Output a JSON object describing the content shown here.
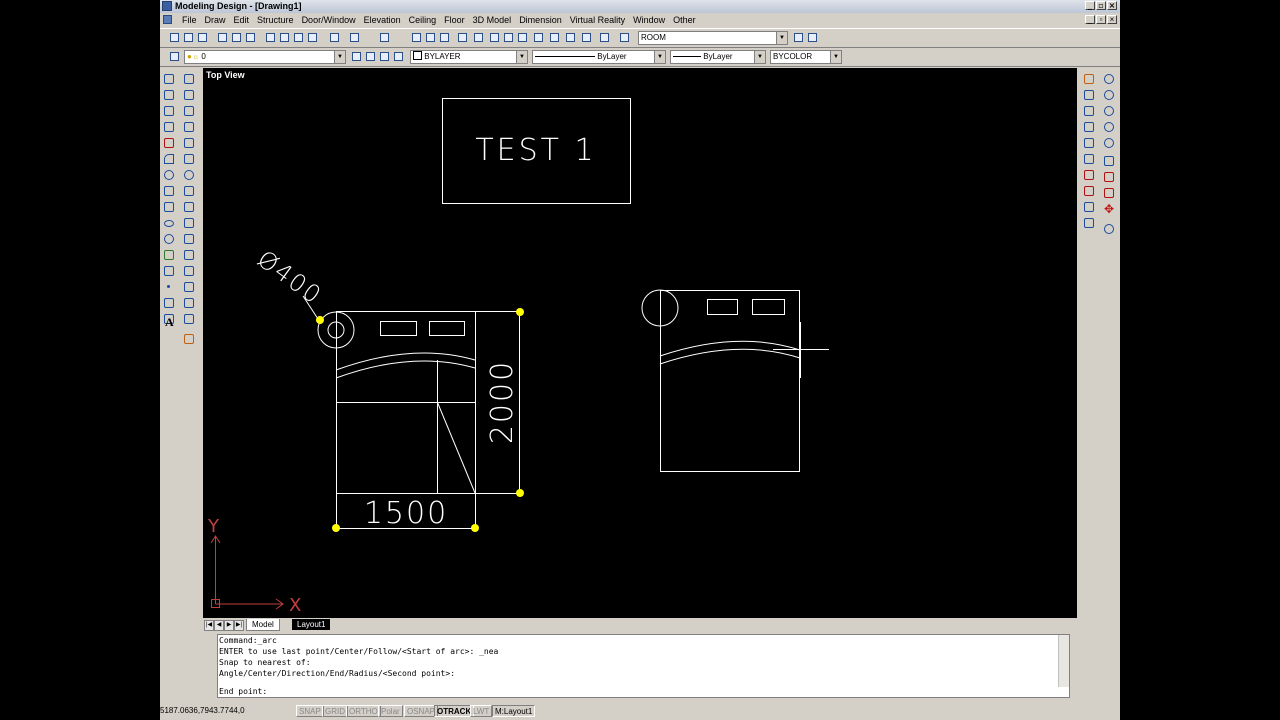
{
  "window": {
    "title": "Modeling Design - [Drawing1]"
  },
  "menu": [
    "File",
    "Draw",
    "Edit",
    "Structure",
    "Door/Window",
    "Elevation",
    "Ceiling",
    "Floor",
    "3D Model",
    "Dimension",
    "Virtual Reality",
    "Window",
    "Other"
  ],
  "toolbar": {
    "room_combo": "ROOM"
  },
  "layers_toolbar": {
    "layer": "0",
    "color": "BYLAYER",
    "linetype": "ByLayer",
    "lineweight": "ByLayer",
    "plotstyle": "BYCOLOR"
  },
  "viewport": {
    "label": "Top View",
    "test_text": "TEST 1",
    "dim_diameter": "Ø400",
    "dim_height": "2000",
    "dim_width": "1500",
    "axis_x": "X",
    "axis_y": "Y"
  },
  "tabs": [
    "Model",
    "Layout1"
  ],
  "command": {
    "history": [
      "Command:_arc",
      "ENTER to use last point/Center/Follow/<Start of arc>: _nea",
      "Snap to nearest of:",
      "Angle/Center/Direction/End/Radius/<Second point>:"
    ],
    "prompt": "End point:"
  },
  "status": {
    "coords": "5187.0636,7943.7744,0",
    "buttons": [
      "SNAP",
      "GRID",
      "ORTHO",
      "Polar",
      "OSNAP",
      "OTRACK",
      "LWT",
      "M:Layout1"
    ]
  },
  "colors": {
    "drawing_line": "#ffffff",
    "grip": "#ffff00",
    "ui_face": "#d4d0c8"
  }
}
